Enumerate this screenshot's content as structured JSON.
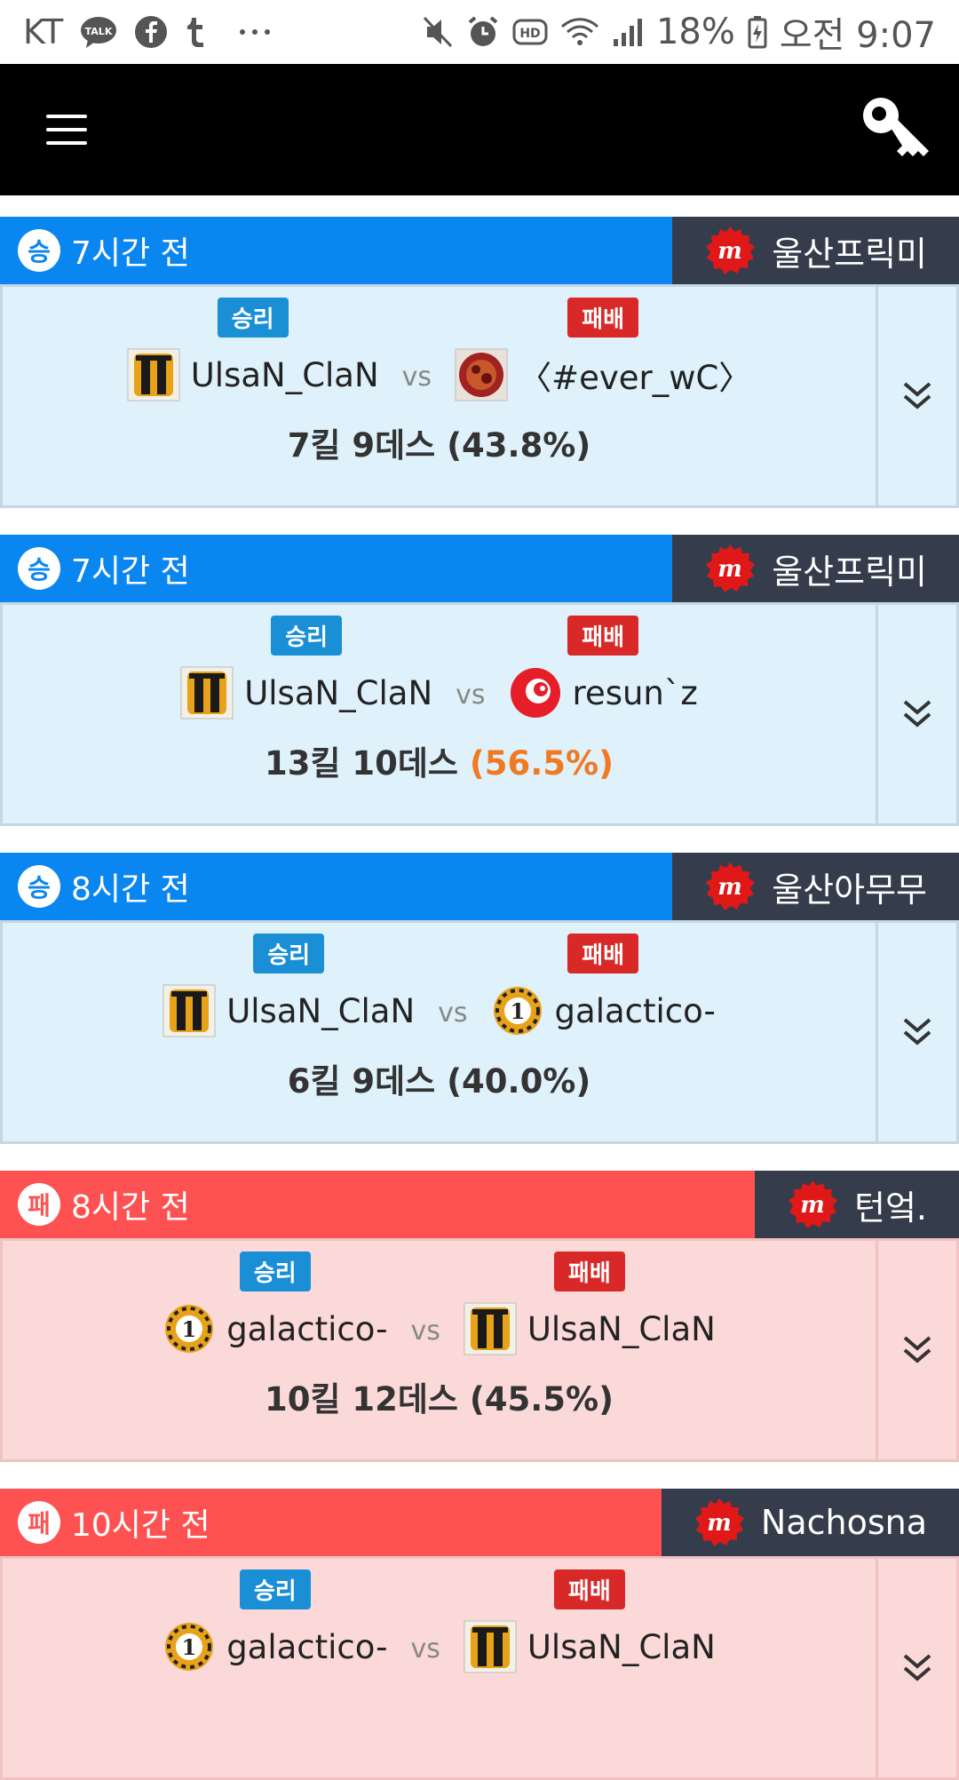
{
  "status_bar": {
    "carrier": "KT",
    "battery": "18%",
    "time": "오전 9:07",
    "left_icons": [
      "kakaotalk-icon",
      "facebook-icon",
      "tumblr-icon",
      "more-dots-icon"
    ],
    "right_icons": [
      "mute-icon",
      "alarm-icon",
      "hd-icon",
      "wifi-icon",
      "signal-icon",
      "battery-icon"
    ],
    "kakao_label": "TALK",
    "hd_label": "HD"
  },
  "header": {
    "menu_icon": "hamburger-icon",
    "action_icon": "key-icon"
  },
  "colors": {
    "win": "#0a86f0",
    "loss": "#fe5252",
    "map_panel": "#353d4c",
    "win_pill": "#1a8fd6",
    "loss_pill": "#d82828",
    "highlight_pct": "#f07a22"
  },
  "labels": {
    "win": "승리",
    "loss": "패배",
    "vs": "vs"
  },
  "matches": [
    {
      "result": "win",
      "badge": "승",
      "time": "7시간 전",
      "map": "울산프릭미",
      "winner": "UlsaN_ClaN",
      "loser": "〈#ever_wC〉",
      "kills": "7킬",
      "deaths": "9데스",
      "pct": "(43.8%)",
      "highlight": false
    },
    {
      "result": "win",
      "badge": "승",
      "time": "7시간 전",
      "map": "울산프릭미",
      "winner": "UlsaN_ClaN",
      "loser": "resun`z",
      "kills": "13킬",
      "deaths": "10데스",
      "pct": "(56.5%)",
      "highlight": true
    },
    {
      "result": "win",
      "badge": "승",
      "time": "8시간 전",
      "map": "울산아무무",
      "winner": "UlsaN_ClaN",
      "loser": "galactico-",
      "kills": "6킬",
      "deaths": "9데스",
      "pct": "(40.0%)",
      "highlight": false
    },
    {
      "result": "loss",
      "badge": "패",
      "time": "8시간 전",
      "map": "턴엌.",
      "winner": "galactico-",
      "loser": "UlsaN_ClaN",
      "kills": "10킬",
      "deaths": "12데스",
      "pct": "(45.5%)",
      "highlight": false
    },
    {
      "result": "loss",
      "badge": "패",
      "time": "10시간 전",
      "map": "Nachosna",
      "winner": "galactico-",
      "loser": "UlsaN_ClaN",
      "kills": "",
      "deaths": "",
      "pct": "",
      "highlight": false
    }
  ]
}
